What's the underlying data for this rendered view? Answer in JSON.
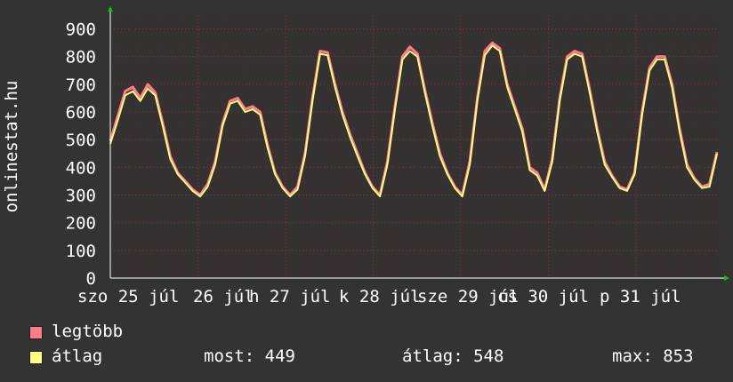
{
  "chart_data": {
    "type": "line",
    "ylabel": "onlinestat.hu",
    "ylim": [
      0,
      950
    ],
    "yticks": [
      0,
      100,
      200,
      300,
      400,
      500,
      600,
      700,
      800,
      900
    ],
    "grid": true,
    "xtick_labels": [
      "szo 25 júl",
      "26 júl",
      "h 27 júl",
      "k 28 júl",
      "sze 29 júl",
      "cs 30 júl",
      "p 31 júl"
    ],
    "series": [
      {
        "name": "legtöbb",
        "color": "#ff7b8a",
        "values": [
          495,
          585,
          675,
          690,
          650,
          700,
          670,
          560,
          440,
          380,
          350,
          320,
          300,
          340,
          420,
          560,
          640,
          650,
          610,
          620,
          600,
          480,
          380,
          330,
          300,
          330,
          450,
          650,
          820,
          815,
          700,
          600,
          520,
          450,
          380,
          330,
          300,
          420,
          620,
          800,
          835,
          810,
          680,
          560,
          450,
          380,
          330,
          300,
          420,
          650,
          820,
          850,
          830,
          700,
          620,
          540,
          400,
          380,
          320,
          430,
          650,
          800,
          820,
          810,
          680,
          540,
          420,
          370,
          330,
          320,
          380,
          600,
          760,
          800,
          800,
          700,
          540,
          410,
          360,
          330,
          340,
          455
        ]
      },
      {
        "name": "átlag",
        "color": "#ffff7e",
        "values": [
          485,
          570,
          660,
          675,
          640,
          685,
          660,
          550,
          430,
          375,
          345,
          315,
          295,
          330,
          410,
          550,
          630,
          640,
          600,
          610,
          590,
          470,
          375,
          325,
          295,
          320,
          440,
          640,
          810,
          805,
          690,
          590,
          510,
          440,
          375,
          325,
          295,
          410,
          610,
          790,
          820,
          800,
          670,
          550,
          440,
          375,
          325,
          295,
          410,
          640,
          805,
          840,
          820,
          690,
          610,
          530,
          390,
          370,
          315,
          420,
          640,
          790,
          810,
          800,
          670,
          530,
          410,
          365,
          325,
          315,
          375,
          590,
          750,
          790,
          790,
          690,
          530,
          400,
          355,
          325,
          330,
          449
        ]
      }
    ]
  },
  "legend": [
    {
      "label": "legtöbb",
      "color": "#ff7b8a"
    },
    {
      "label": "átlag",
      "color": "#ffff7e"
    }
  ],
  "stats": {
    "now": "most: 449",
    "avg": "átlag: 548",
    "max": "max: 853"
  },
  "colors": {
    "background": "#333333",
    "axis": "#ffffff",
    "grid": "#ff0000",
    "arrow": "#00cc00"
  }
}
